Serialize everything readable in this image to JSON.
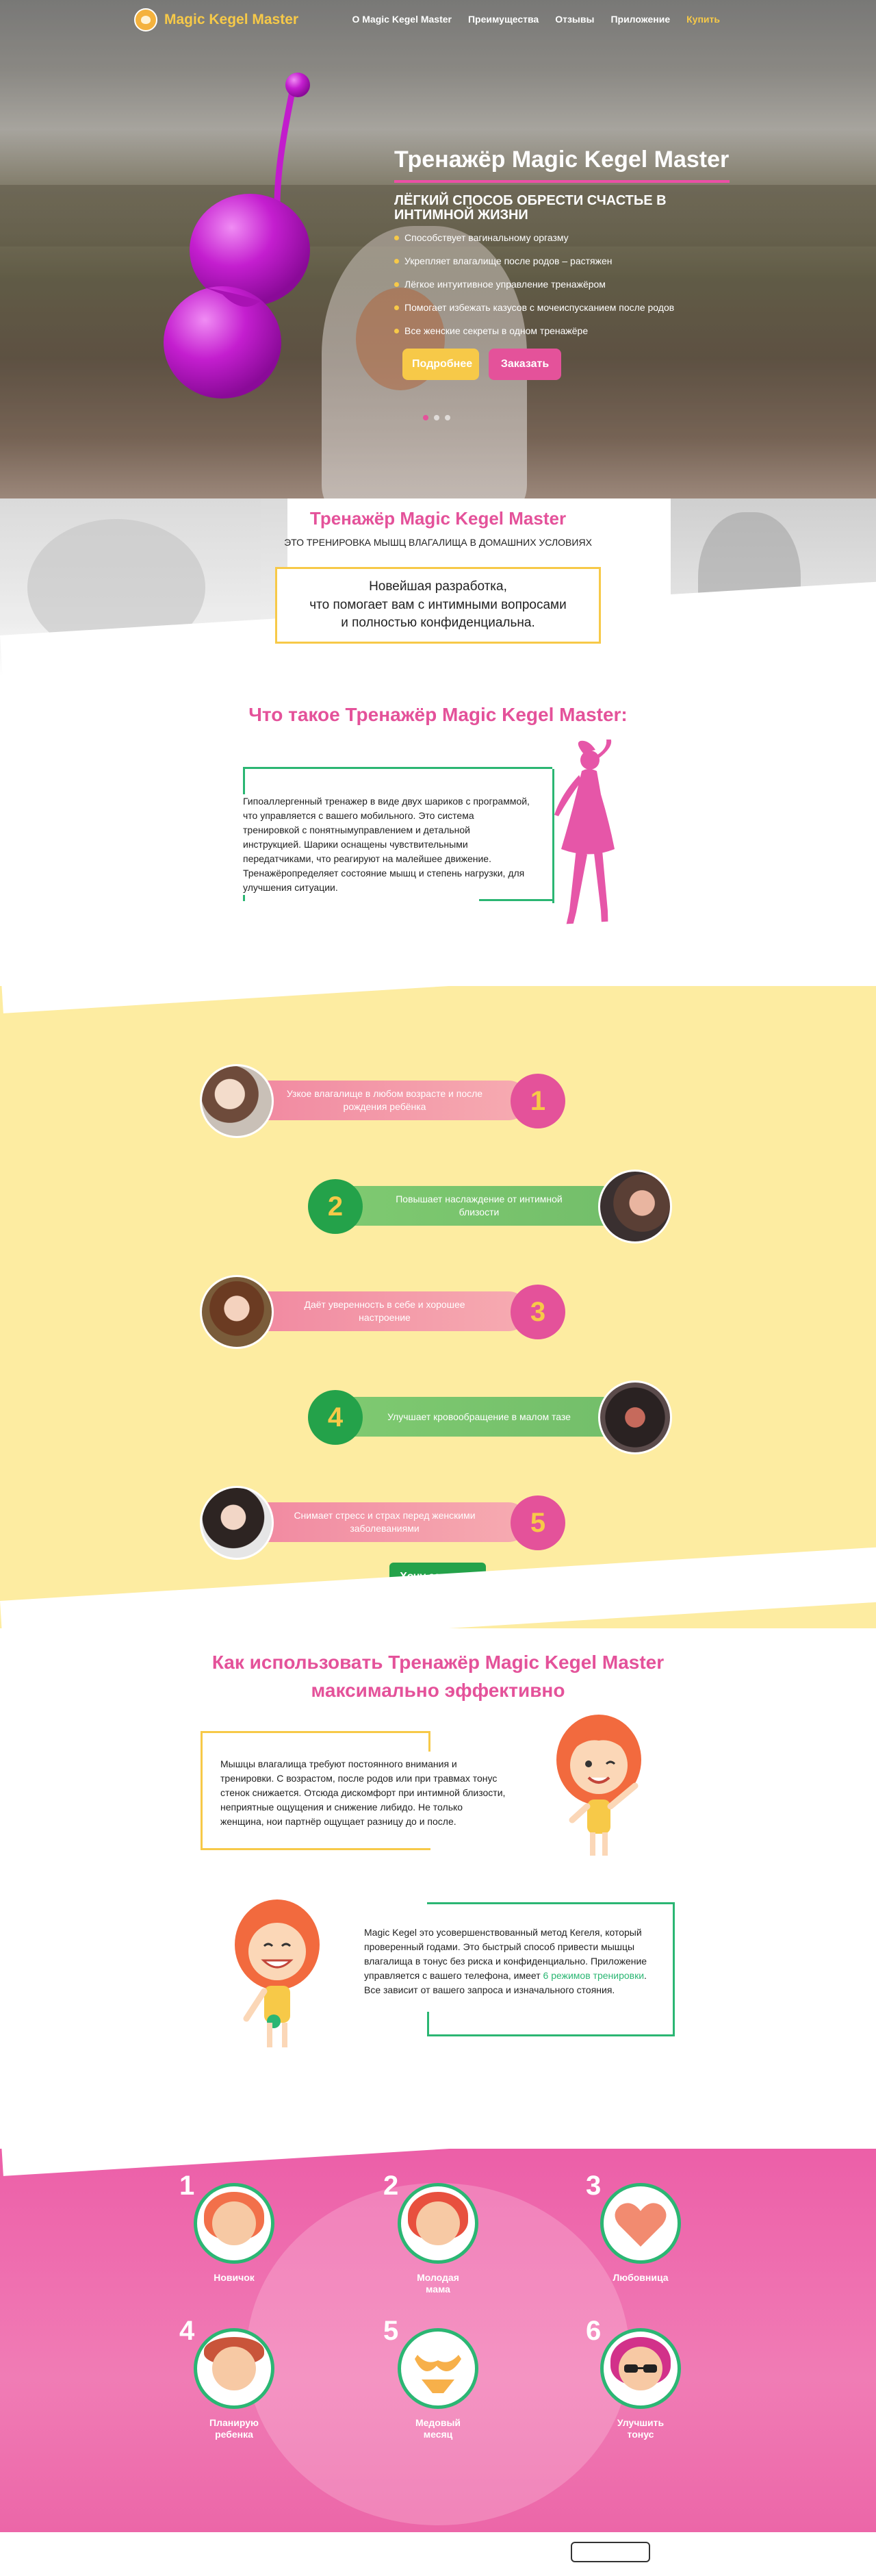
{
  "header": {
    "logo_text": "Magic Kegel Master",
    "nav": [
      {
        "label": "О Magic Kegel Master"
      },
      {
        "label": "Преимущества"
      },
      {
        "label": "Отзывы"
      },
      {
        "label": "Приложение"
      },
      {
        "label": "Купить"
      }
    ]
  },
  "hero": {
    "title": "Тренажёр Magic Kegel Master",
    "subtitle": "ЛЁГКИЙ СПОСОБ ОБРЕСТИ СЧАСТЬЕ В ИНТИМНОЙ ЖИЗНИ",
    "bullets": [
      "Способствует вагинальному оргазму",
      "Укрепляет влагалище после родов – растяжен",
      "Лёгкое интуитивное управление тренажёром",
      "Помогает избежать казусов с мочеиспусканием после родов",
      "Все женские секреты в одном тренажёре"
    ],
    "btn_more": "Подробнее",
    "btn_order": "Заказать"
  },
  "intro": {
    "title": "Тренажёр Magic Kegel Master",
    "subtitle": "ЭТО ТРЕНИРОВКА МЫШЦ ВЛАГАЛИЩА В ДОМАШНИХ УСЛОВИЯХ",
    "box_line1": "Новейшая разработка,",
    "box_line2": "что помогает вам с интимными вопросами",
    "box_line3": "и полностью конфиденциальна."
  },
  "whatis": {
    "title": "Что такое Тренажёр Magic Kegel Master:",
    "text": "Гипоаллергенный тренажер в виде двух шариков с программой, что управляется с вашего мобильного. Это система тренировкой с понятнымуправлением и детальной инструкцией. Шарики оснащены чувствительными передатчиками, что реагируют на малейшее движение. Тренажёропределяет состояние мышц и степень нагрузки, для улучшения ситуации."
  },
  "benefits": {
    "items": [
      {
        "num": "1",
        "text": "Узкое влагалище в любом возрасте и после рождения ребёнка"
      },
      {
        "num": "2",
        "text": "Повышает наслаждение от интимной близости"
      },
      {
        "num": "3",
        "text": "Даёт уверенность в себе и хорошее настроение"
      },
      {
        "num": "4",
        "text": "Улучшает кровообращение в малом тазе"
      },
      {
        "num": "5",
        "text": "Снимает стресс и страх перед женскими заболеваниями"
      }
    ],
    "cta": "Хочу заказать"
  },
  "howto": {
    "title_line1": "Как использовать Тренажёр Magic Kegel Master",
    "title_line2": "максимально эффективно",
    "text1": "Мышцы влагалища требуют постоянного внимания и тренировки. С возрастом, после родов или при травмах тонус стенок снижается. Отсюда дискомфорт при интимной близости, неприятные ощущения и снижение либидо. Не только женщина, нои партнёр ощущает разницу до и после.",
    "text2_a": "Magic Kegel это усовершенствованный метод Кегеля, который проверенный годами. Это быстрый способ привести мышцы влагалища в тонус без риска и конфиденциально. Приложение управляется с вашего телефона, имеет ",
    "text2_link": "6 режимов тренировки",
    "text2_b": ". Все зависит от вашего запроса и изначального стояния."
  },
  "levels": {
    "items": [
      {
        "num": "1",
        "label": "Новичок"
      },
      {
        "num": "2",
        "label": "Молодая мама"
      },
      {
        "num": "3",
        "label": "Любовница"
      },
      {
        "num": "4",
        "label": "Планирую ребенка"
      },
      {
        "num": "5",
        "label": "Медовый месяц"
      },
      {
        "num": "6",
        "label": "Улучшить тонус"
      }
    ]
  },
  "colors": {
    "pink": "#e4529a",
    "yellow": "#f7c948",
    "green": "#24a24a",
    "benefits_bg": "#fdeca1"
  }
}
